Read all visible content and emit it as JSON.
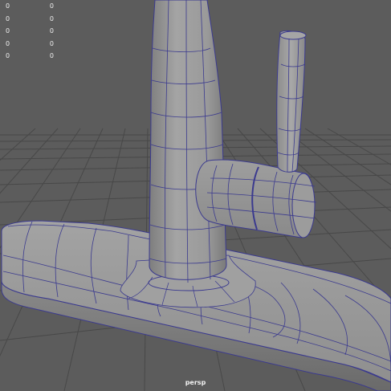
{
  "viewport": {
    "camera_label": "persp",
    "background_color": "#5c5c5c",
    "grid_color": "#474747",
    "wire_color": "#3b3a8f",
    "mesh_color": "#9b9b9b"
  },
  "hud": {
    "rows": [
      {
        "left": "0",
        "right": "0"
      },
      {
        "left": "0",
        "right": "0"
      },
      {
        "left": "0",
        "right": "0"
      },
      {
        "left": "0",
        "right": "0"
      },
      {
        "left": "0",
        "right": "0"
      }
    ]
  }
}
